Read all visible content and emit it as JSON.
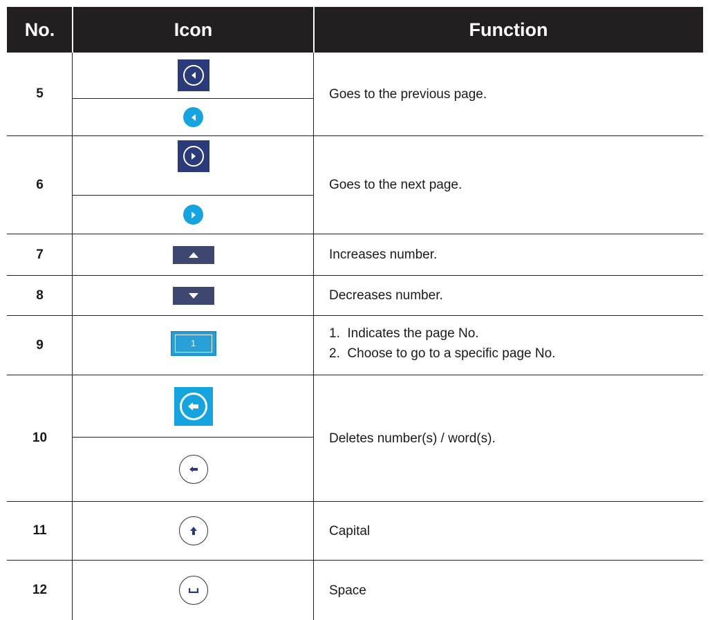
{
  "header": {
    "no": "No.",
    "icon": "Icon",
    "function": "Function"
  },
  "rows": [
    {
      "no": "5",
      "function": "Goes to the previous page.",
      "icons": [
        "prev-page-icon-navy",
        "prev-page-icon-cyan"
      ]
    },
    {
      "no": "6",
      "function": "Goes to the next page.",
      "icons": [
        "next-page-icon-navy",
        "next-page-icon-cyan"
      ]
    },
    {
      "no": "7",
      "function": "Increases number.",
      "icons": [
        "up-arrow-icon"
      ]
    },
    {
      "no": "8",
      "function": "Decreases number.",
      "icons": [
        "down-arrow-icon"
      ]
    },
    {
      "no": "9",
      "function_lines": [
        "1.  Indicates the page No.",
        "2.  Choose to go to a specific page No."
      ],
      "icons": [
        "page-number-box"
      ],
      "page_box_value": "1"
    },
    {
      "no": "10",
      "function": "Deletes number(s) / word(s).",
      "icons": [
        "backspace-icon-cyan",
        "backspace-icon-outline"
      ]
    },
    {
      "no": "11",
      "function": "Capital",
      "icons": [
        "shift-icon"
      ]
    },
    {
      "no": "12",
      "function": "Space",
      "icons": [
        "space-icon"
      ]
    }
  ],
  "colors": {
    "header_bg": "#231f20",
    "navy": "#2a3a7a",
    "cyan": "#14a4e0",
    "slate": "#3d4770"
  }
}
